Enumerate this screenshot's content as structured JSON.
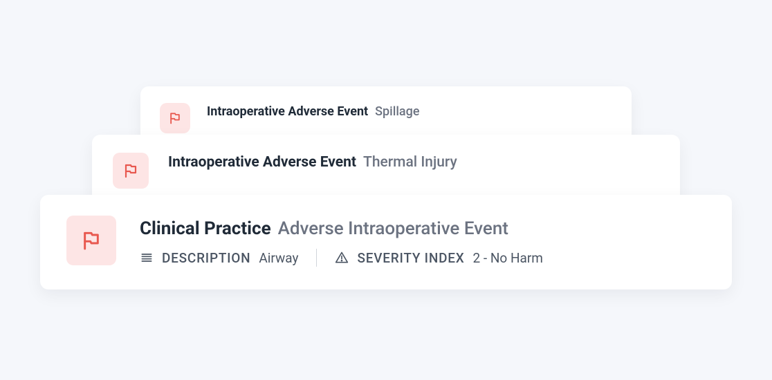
{
  "colors": {
    "flag_icon": "#e8584f",
    "icon_bg": "#fde5e5"
  },
  "cards": [
    {
      "strong": "Intraoperative Adverse Event",
      "muted": "Spillage"
    },
    {
      "strong": "Intraoperative Adverse Event",
      "muted": "Thermal Injury"
    },
    {
      "strong": "Clinical Practice",
      "muted": "Adverse Intraoperative Event",
      "details": {
        "description_label": "DESCRIPTION",
        "description_value": "Airway",
        "severity_label": "SEVERITY INDEX",
        "severity_value": "2 - No Harm"
      }
    }
  ]
}
